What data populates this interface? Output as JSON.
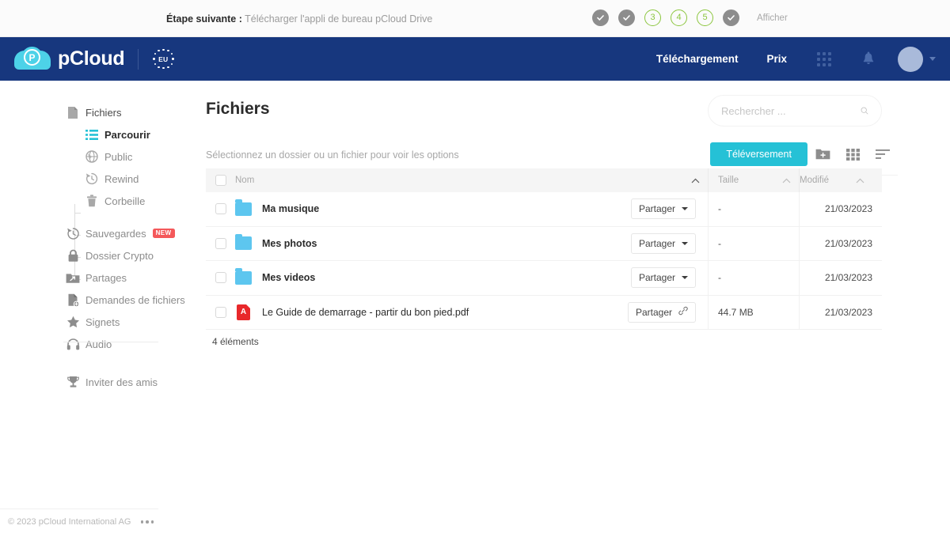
{
  "onboarding": {
    "lead": "Étape suivante :",
    "task": "Télécharger l'appli de bureau pCloud Drive",
    "steps": [
      {
        "state": "done",
        "label": ""
      },
      {
        "state": "done",
        "label": ""
      },
      {
        "state": "todo",
        "label": "3"
      },
      {
        "state": "todo",
        "label": "4"
      },
      {
        "state": "todo",
        "label": "5"
      },
      {
        "state": "done",
        "label": ""
      }
    ],
    "show_label": "Afficher"
  },
  "topnav": {
    "brand": "pCloud",
    "eu_badge": "EU",
    "links": [
      {
        "label": "Téléchargement",
        "name": "nav-telechargement"
      },
      {
        "label": "Prix",
        "name": "nav-prix"
      }
    ]
  },
  "sidebar": {
    "root": {
      "label": "Fichiers",
      "icon": "file-icon"
    },
    "sub_items": [
      {
        "label": "Parcourir",
        "icon": "list-icon",
        "active": true
      },
      {
        "label": "Public",
        "icon": "globe-icon",
        "active": false
      },
      {
        "label": "Rewind",
        "icon": "rewind-icon",
        "active": false
      },
      {
        "label": "Corbeille",
        "icon": "trash-icon",
        "active": false
      }
    ],
    "items": [
      {
        "label": "Sauvegardes",
        "icon": "backup-icon",
        "badge": "NEW"
      },
      {
        "label": "Dossier Crypto",
        "icon": "lock-icon",
        "badge": ""
      },
      {
        "label": "Partages",
        "icon": "shared-folder-icon",
        "badge": ""
      },
      {
        "label": "Demandes de fichiers",
        "icon": "file-request-icon",
        "badge": ""
      },
      {
        "label": "Signets",
        "icon": "star-icon",
        "badge": ""
      },
      {
        "label": "Audio",
        "icon": "headphones-icon",
        "badge": ""
      }
    ],
    "invite": {
      "label": "Inviter des amis",
      "icon": "trophy-icon"
    },
    "footer": {
      "copyright": "© 2023 pCloud International AG"
    }
  },
  "main": {
    "title": "Fichiers",
    "search": {
      "placeholder": "Rechercher ...",
      "value": ""
    },
    "toolbar": {
      "hint": "Sélectionnez un dossier ou un fichier pour voir les options",
      "upload_label": "Téléversement",
      "icons": [
        "new-folder-icon",
        "grid-view-icon",
        "sort-icon"
      ]
    },
    "table": {
      "headers": {
        "name": "Nom",
        "size": "Taille",
        "modified": "Modifié"
      },
      "share_label": "Partager",
      "rows": [
        {
          "type": "folder",
          "name": "Ma musique",
          "size": "-",
          "modified": "21/03/2023",
          "share_icon": "chevron-down"
        },
        {
          "type": "folder",
          "name": "Mes photos",
          "size": "-",
          "modified": "21/03/2023",
          "share_icon": "chevron-down"
        },
        {
          "type": "folder",
          "name": "Mes videos",
          "size": "-",
          "modified": "21/03/2023",
          "share_icon": "chevron-down"
        },
        {
          "type": "pdf",
          "name": "Le Guide de demarrage - partir du bon pied.pdf",
          "size": "44.7 MB",
          "modified": "21/03/2023",
          "share_icon": "link"
        }
      ],
      "count": "4 éléments"
    }
  },
  "colors": {
    "navy": "#17377e",
    "cyan": "#25c1d6",
    "folder_blue": "#5dc6ef",
    "pdf_red": "#e8282b",
    "badge_red": "#f4585a",
    "step_green": "#8cc63f"
  }
}
